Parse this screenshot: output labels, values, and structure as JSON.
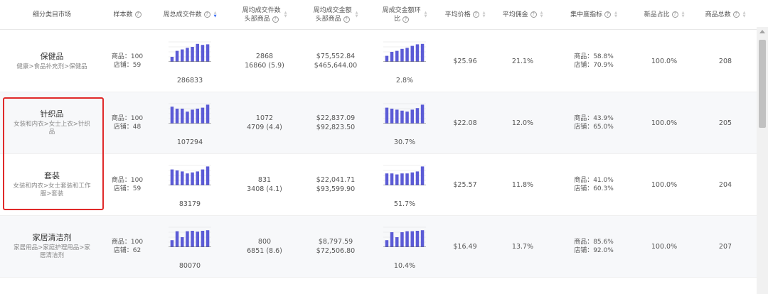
{
  "header": {
    "segment": "细分类目市场",
    "sample": "样本数",
    "weekly_orders": "周总成交件数",
    "top_orders_l1": "周均成交件数",
    "top_orders_l2": "头部商品",
    "top_amount_l1": "周均成交金额",
    "top_amount_l2": "头部商品",
    "amount_wow_l1": "周成交金额环",
    "amount_wow_l2": "比",
    "avg_price": "平均价格",
    "avg_commission": "平均佣金",
    "concentration": "集中度指标",
    "new_ratio": "新品占比",
    "total_products": "商品总数"
  },
  "colors": {
    "accent": "#3a6cf4",
    "bar": "#5b5bd6",
    "highlight": "#e02a2a"
  },
  "rows": [
    {
      "name": "保健品",
      "path": [
        "健康>食品补充剂>保健品"
      ],
      "sample": [
        "商品：100",
        "店铺：59"
      ],
      "weekly_total": "286833",
      "weekly_bars": [
        0.25,
        0.55,
        0.62,
        0.7,
        0.75,
        0.9,
        0.85,
        0.88
      ],
      "top_orders": [
        "2868",
        "16860 (5.9)"
      ],
      "top_amount": [
        "$75,552.84",
        "$465,644.00"
      ],
      "wow_bars": [
        0.3,
        0.5,
        0.55,
        0.65,
        0.7,
        0.8,
        0.88,
        0.9
      ],
      "wow": "2.8%",
      "avg_price": "$25.96",
      "avg_commission": "21.1%",
      "concentration": [
        "商品：58.8%",
        "店铺：70.9%"
      ],
      "new_ratio": "100.0%",
      "total": "208"
    },
    {
      "name": "针织品",
      "path": [
        "女装和内衣>女士上衣>针织",
        "品"
      ],
      "sample": [
        "商品：100",
        "店铺：48"
      ],
      "weekly_total": "107294",
      "weekly_bars": [
        0.85,
        0.75,
        0.75,
        0.6,
        0.7,
        0.75,
        0.8,
        0.95
      ],
      "top_orders": [
        "1072",
        "4709 (4.4)"
      ],
      "top_amount": [
        "$22,837.09",
        "$92,823.50"
      ],
      "wow_bars": [
        0.8,
        0.75,
        0.7,
        0.65,
        0.6,
        0.7,
        0.78,
        0.95
      ],
      "wow": "30.7%",
      "avg_price": "$22.08",
      "avg_commission": "12.0%",
      "concentration": [
        "商品：43.9%",
        "店铺：65.0%"
      ],
      "new_ratio": "100.0%",
      "total": "205"
    },
    {
      "name": "套装",
      "path": [
        "女装和内衣>女士套装和工作",
        "服>套装"
      ],
      "sample": [
        "商品：100",
        "店铺：59"
      ],
      "weekly_total": "83179",
      "weekly_bars": [
        0.8,
        0.75,
        0.7,
        0.6,
        0.65,
        0.7,
        0.8,
        0.95
      ],
      "top_orders": [
        "831",
        "3408 (4.1)"
      ],
      "top_amount": [
        "$22,041.71",
        "$93,599.90"
      ],
      "wow_bars": [
        0.6,
        0.6,
        0.55,
        0.6,
        0.6,
        0.65,
        0.7,
        0.95
      ],
      "wow": "51.7%",
      "avg_price": "$25.57",
      "avg_commission": "11.8%",
      "concentration": [
        "商品：41.0%",
        "店铺：60.3%"
      ],
      "new_ratio": "100.0%",
      "total": "204"
    },
    {
      "name": "家居清洁剂",
      "path": [
        "家居用品>家庭护理用品>家",
        "居清洁剂"
      ],
      "sample": [
        "商品：100",
        "店铺：62"
      ],
      "weekly_total": "80070",
      "weekly_bars": [
        0.35,
        0.8,
        0.5,
        0.8,
        0.82,
        0.78,
        0.82,
        0.85
      ],
      "top_orders": [
        "800",
        "6851 (8.6)"
      ],
      "top_amount": [
        "$8,797.59",
        "$72,506.80"
      ],
      "wow_bars": [
        0.35,
        0.75,
        0.5,
        0.75,
        0.8,
        0.8,
        0.82,
        0.85
      ],
      "wow": "10.4%",
      "avg_price": "$16.49",
      "avg_commission": "13.7%",
      "concentration": [
        "商品：85.6%",
        "店铺：92.0%"
      ],
      "new_ratio": "100.0%",
      "total": "207"
    }
  ]
}
